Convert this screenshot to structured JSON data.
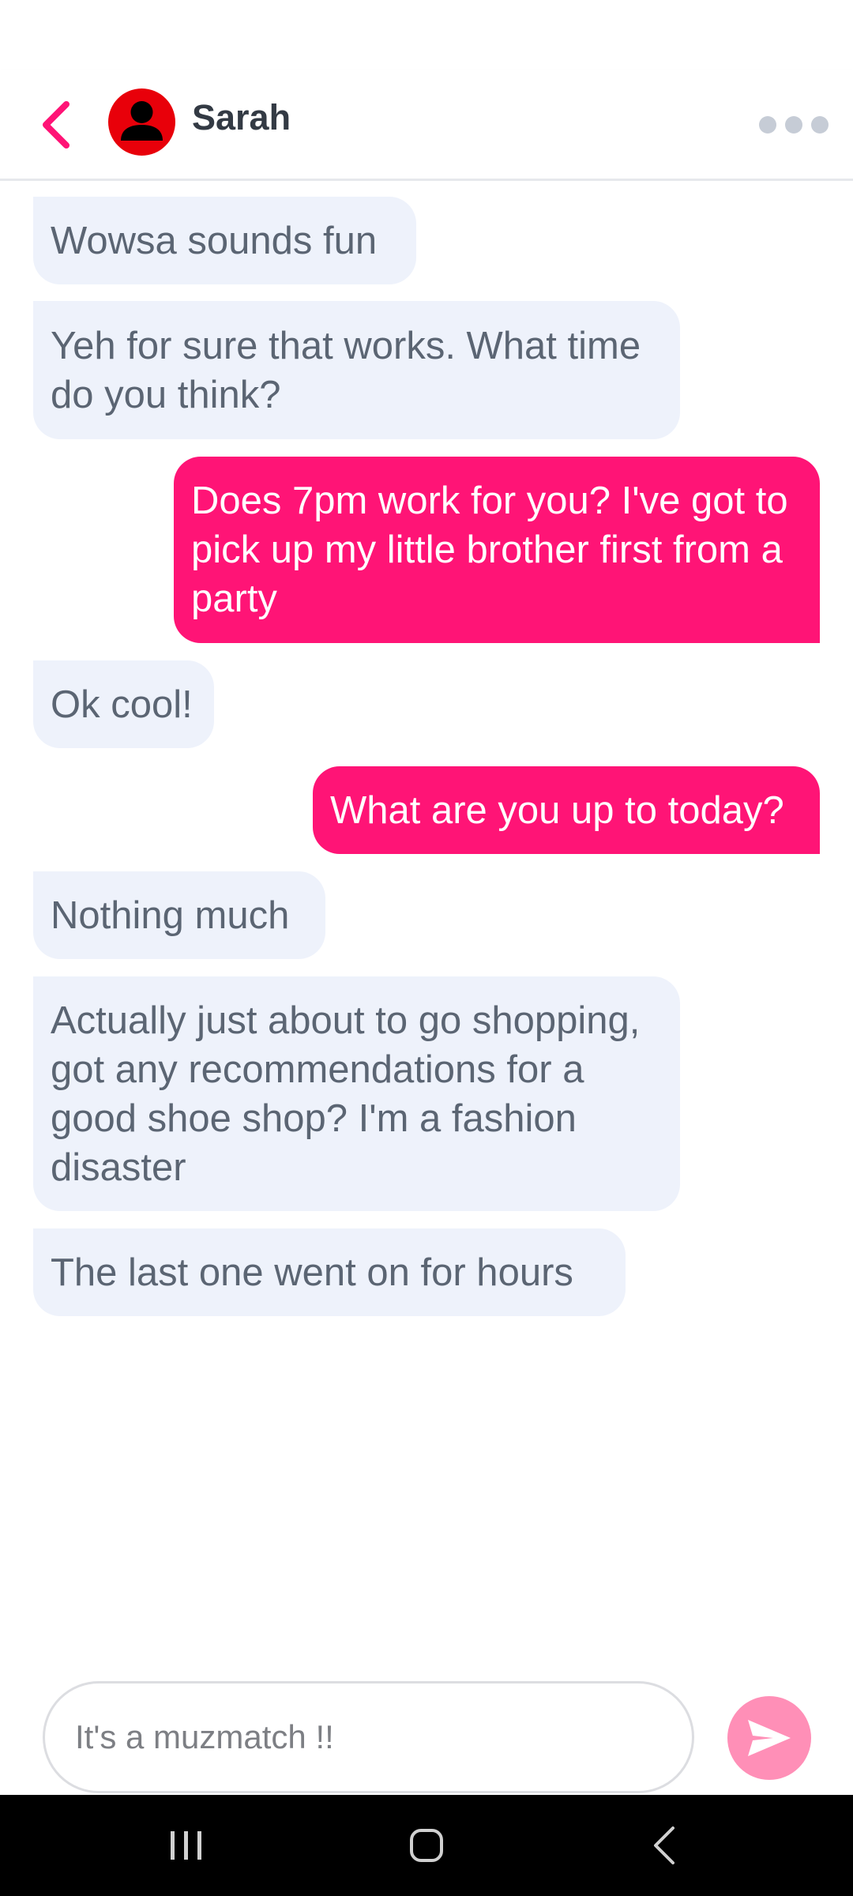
{
  "header": {
    "contact_name": "Sarah",
    "back_icon": "chevron-left-icon",
    "avatar_icon": "person-icon",
    "more_icon": "more-horizontal-icon"
  },
  "messages": [
    {
      "direction": "incoming",
      "text": "Wowsa sounds fun"
    },
    {
      "direction": "incoming",
      "text": "Yeh for sure that works. What time do you think?"
    },
    {
      "direction": "outgoing",
      "text": "Does 7pm work for you? I've got to pick up my little brother first from a party"
    },
    {
      "direction": "incoming",
      "text": "Ok cool!"
    },
    {
      "direction": "outgoing",
      "text": "What are you up to today?"
    },
    {
      "direction": "incoming",
      "text": "Nothing much"
    },
    {
      "direction": "incoming",
      "text": "Actually just about to go shopping, got any recommendations for a good shoe shop? I'm a fashion disaster"
    },
    {
      "direction": "incoming",
      "text": "The last one went on for hours"
    }
  ],
  "composer": {
    "placeholder": "It's a muzmatch !!",
    "value": "",
    "send_icon": "send-icon"
  },
  "nav": {
    "recents_icon": "recent-apps-icon",
    "home_icon": "home-icon",
    "back_icon": "back-icon"
  },
  "colors": {
    "accent": "#ff1476",
    "incoming_bubble": "#eef2fb",
    "incoming_text": "#5b6573",
    "send_button": "#ff8fb7",
    "avatar_bg": "#e8000a"
  }
}
